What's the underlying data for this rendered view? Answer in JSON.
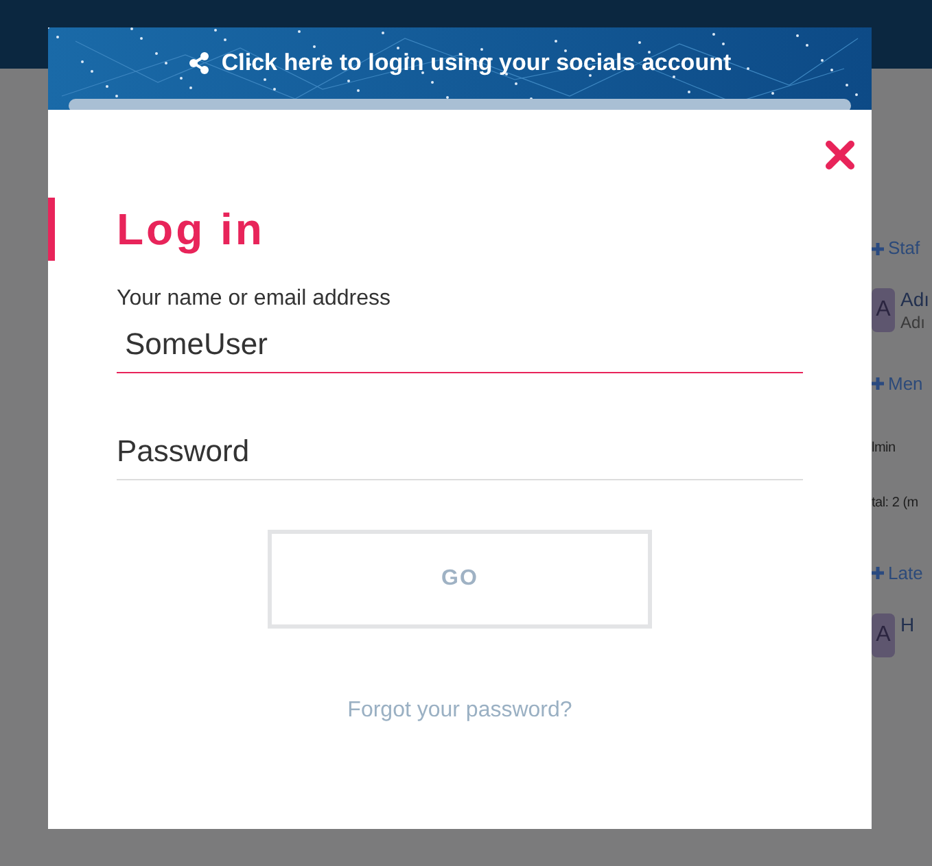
{
  "background": {
    "sidebar": [
      {
        "kind": "heading",
        "text": "Staf"
      },
      {
        "kind": "member",
        "avatar": "A",
        "name": "Adı",
        "role": "Adı"
      },
      {
        "kind": "heading",
        "text": "Men"
      },
      {
        "kind": "line",
        "text": "lmin"
      },
      {
        "kind": "line",
        "text": "tal: 2 (m"
      },
      {
        "kind": "heading",
        "text": "Late"
      },
      {
        "kind": "member",
        "avatar": "A",
        "name": "H"
      }
    ]
  },
  "modal": {
    "social_banner": "Click here to login using your socials account",
    "title": "Log in",
    "fields": [
      {
        "label": "Your name or email address",
        "value": "SomeUser",
        "focused": true
      },
      {
        "placeholder": "Password",
        "focused": false
      }
    ],
    "submit": "GO",
    "forgot_link": "Forgot your password?"
  }
}
